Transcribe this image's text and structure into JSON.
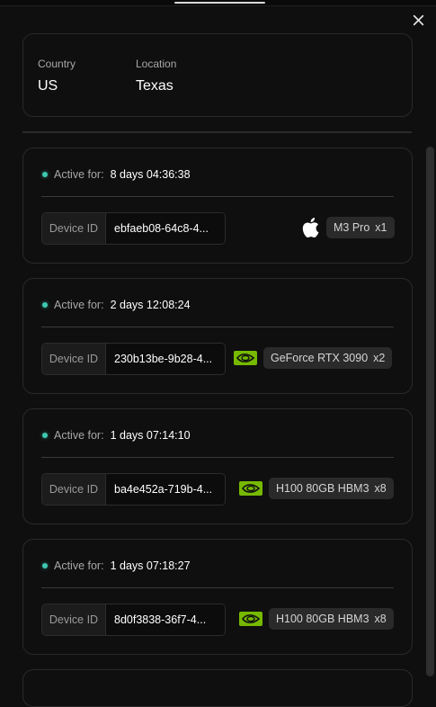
{
  "location": {
    "country_label": "Country",
    "country_value": "US",
    "location_label": "Location",
    "location_value": "Texas"
  },
  "active_label": "Active for:",
  "device_id_label": "Device ID",
  "accent_color": "#3ec9b1",
  "nvidia_color": "#76b900",
  "devices": [
    {
      "active_for": "8 days 04:36:38",
      "device_id": "ebfaeb08-64c8-4...",
      "vendor_icon": "apple-icon",
      "hardware": "M3 Pro",
      "count": "x1"
    },
    {
      "active_for": "2 days 12:08:24",
      "device_id": "230b13be-9b28-4...",
      "vendor_icon": "nvidia-icon",
      "hardware": "GeForce RTX 3090",
      "count": "x2"
    },
    {
      "active_for": "1 days 07:14:10",
      "device_id": "ba4e452a-719b-4...",
      "vendor_icon": "nvidia-icon",
      "hardware": "H100 80GB HBM3",
      "count": "x8"
    },
    {
      "active_for": "1 days 07:18:27",
      "device_id": "8d0f3838-36f7-4...",
      "vendor_icon": "nvidia-icon",
      "hardware": "H100 80GB HBM3",
      "count": "x8"
    }
  ]
}
